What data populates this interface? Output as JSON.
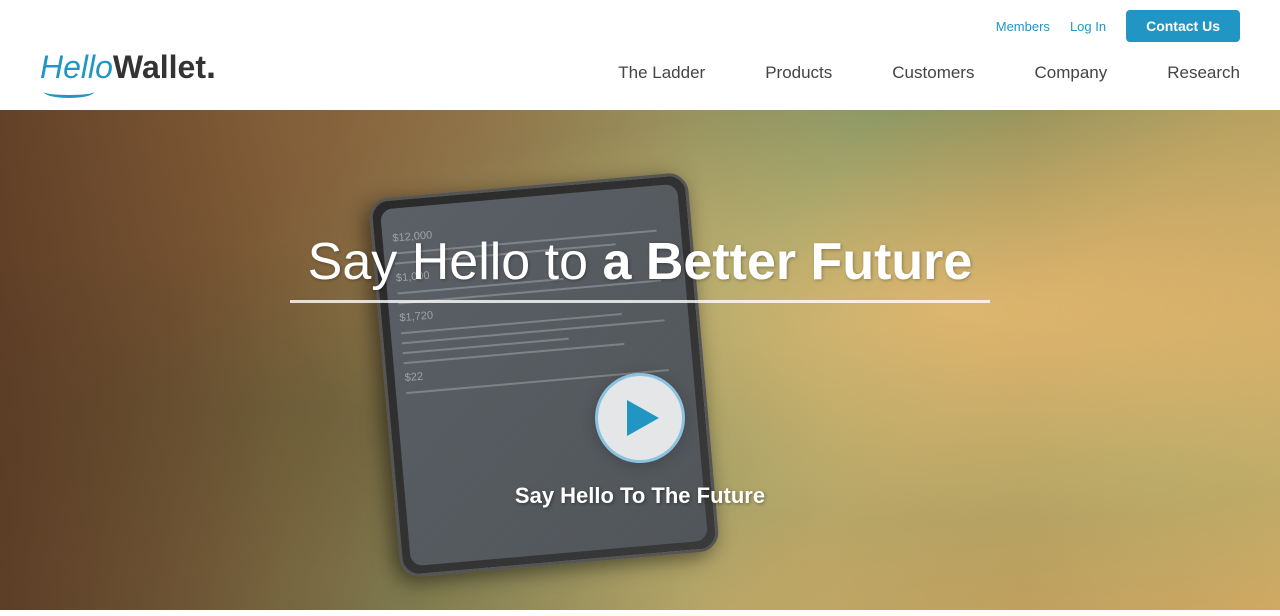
{
  "header": {
    "logo": {
      "hello": "Hello",
      "wallet": "Wallet",
      "dot": "."
    },
    "top_links": {
      "members": "Members",
      "login": "Log In",
      "contact": "Contact Us"
    },
    "nav": {
      "items": [
        {
          "id": "the-ladder",
          "label": "The Ladder"
        },
        {
          "id": "products",
          "label": "Products"
        },
        {
          "id": "customers",
          "label": "Customers"
        },
        {
          "id": "company",
          "label": "Company"
        },
        {
          "id": "research",
          "label": "Research"
        }
      ]
    }
  },
  "hero": {
    "headline_normal": "Say Hello to ",
    "headline_bold": "a Better Future",
    "video_label": "Say Hello To The Future"
  },
  "colors": {
    "brand_blue": "#2196c4",
    "nav_text": "#444444",
    "white": "#ffffff"
  }
}
